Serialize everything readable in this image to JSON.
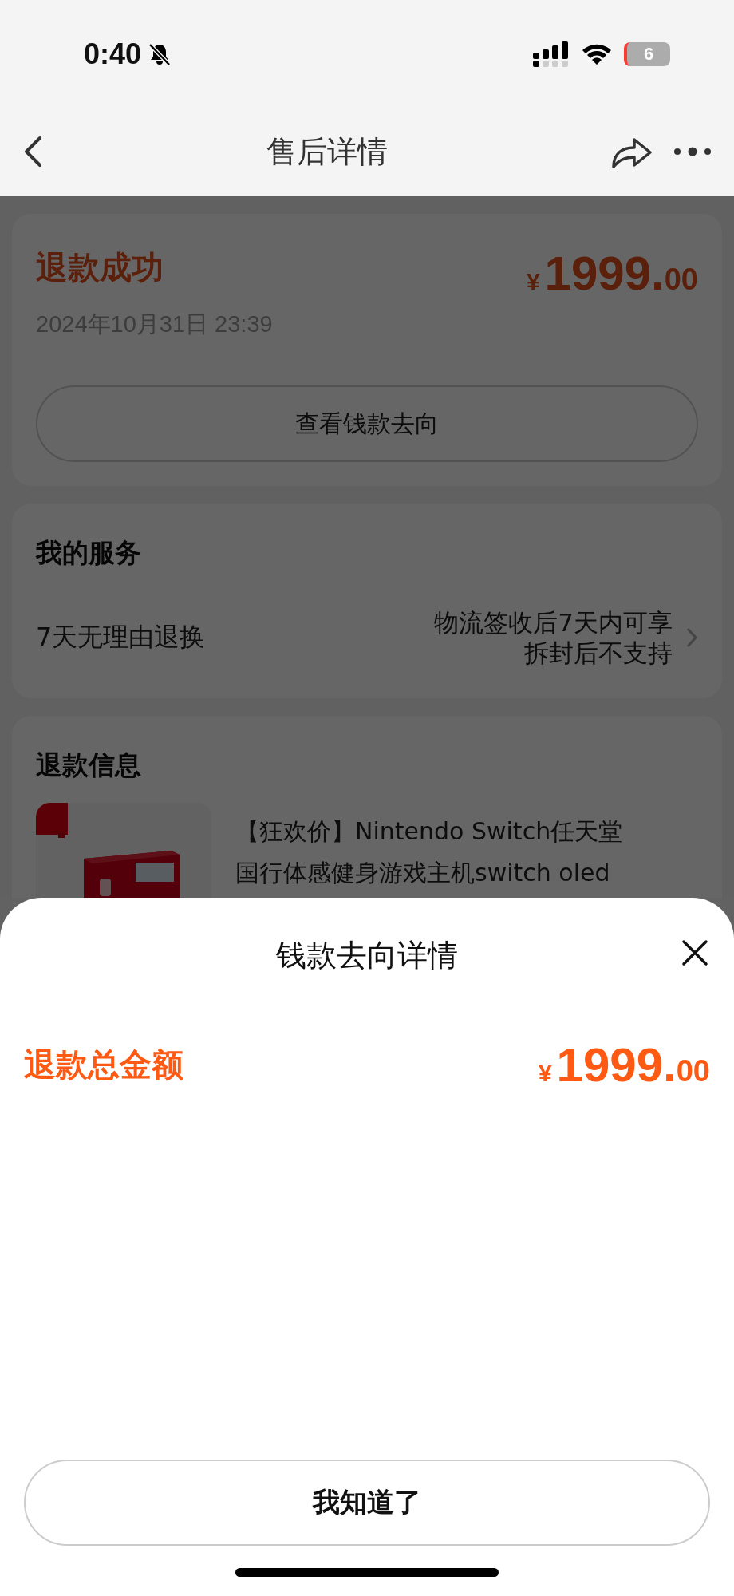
{
  "status_bar": {
    "time": "0:40",
    "battery": "6"
  },
  "nav": {
    "title": "售后详情"
  },
  "refund_status": {
    "title": "退款成功",
    "date": "2024年10月31日 23:39",
    "amount": {
      "currency": "¥",
      "integer": "1999.",
      "decimals": "00"
    },
    "button": "查看钱款去向"
  },
  "services": {
    "title": "我的服务",
    "items": [
      {
        "name": "7天无理由退换",
        "lines": [
          "物流签收后7天内可享",
          "拆封后不支持"
        ]
      }
    ]
  },
  "refund_info": {
    "title": "退款信息",
    "product": {
      "title_lines": [
        "【狂欢价】Nintendo Switch任天堂",
        "国行体感健身游戏主机switch oled"
      ]
    }
  },
  "sheet": {
    "title": "钱款去向详情",
    "total_label": "退款总金额",
    "amount": {
      "currency": "¥",
      "integer": "1999.",
      "decimals": "00"
    },
    "confirm": "我知道了"
  }
}
